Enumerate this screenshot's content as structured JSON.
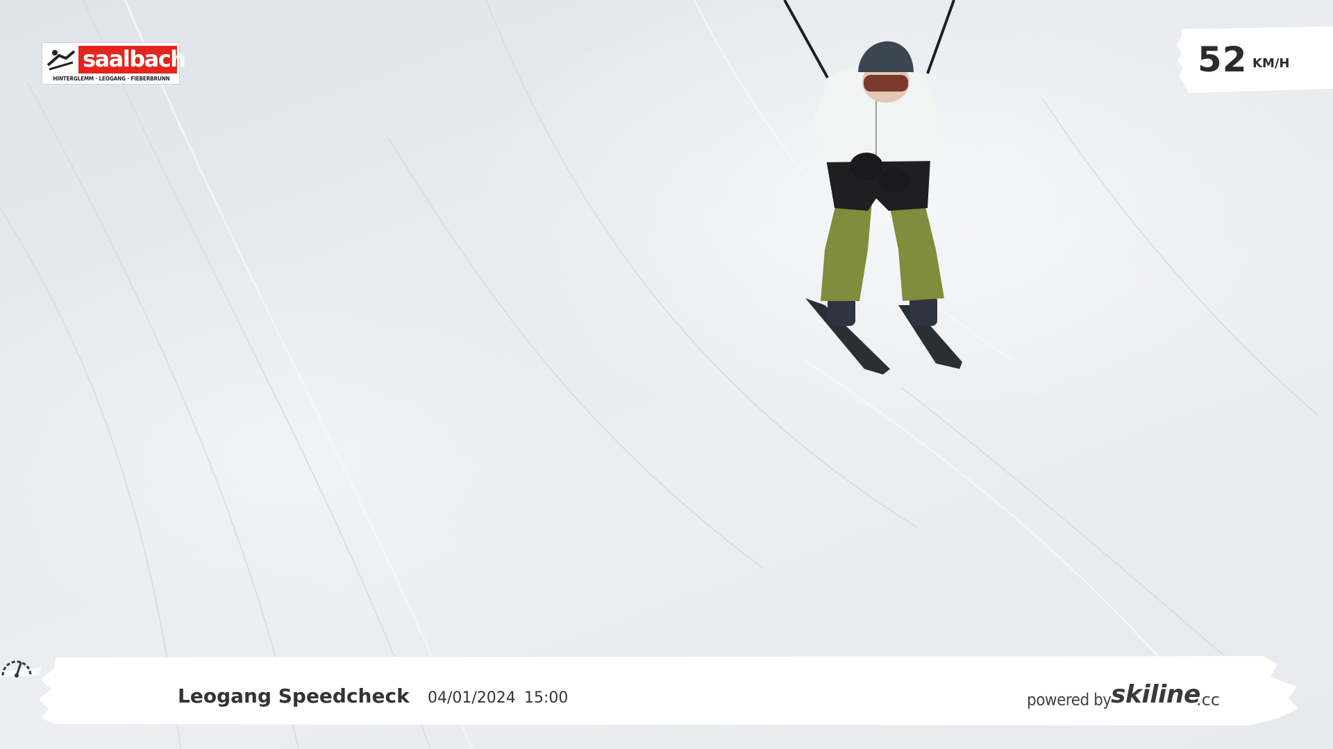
{
  "logo": {
    "wordmark": "saalbach",
    "tagline": "HINTERGLEMM · LEOGANG · FIEBERBRUNN",
    "brand_color": "#e3261d"
  },
  "speed": {
    "value": "52",
    "unit": "KM/H"
  },
  "footer": {
    "icon": "speedometer-icon",
    "title": "Leogang Speedcheck",
    "date": "04/01/2024",
    "time": "15:00",
    "powered_label": "powered by",
    "brand": "skiline",
    "brand_tld": ".cc"
  }
}
